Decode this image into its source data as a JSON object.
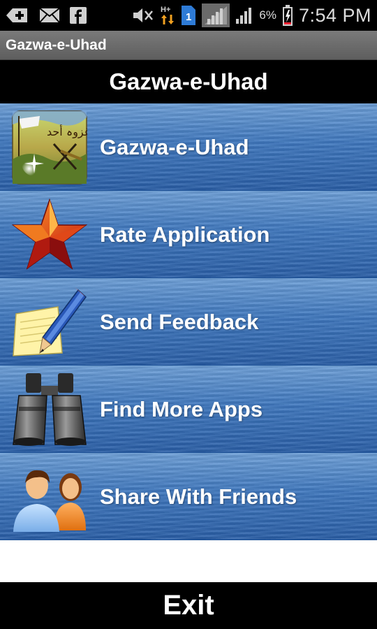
{
  "status_bar": {
    "battery_percent": "6%",
    "time": "7:54 PM",
    "sim_badge": "1",
    "network_label": "H+",
    "left_icons": [
      "add-notification-icon",
      "email-icon",
      "facebook-icon"
    ],
    "right_icons": [
      "mute-icon",
      "data-arrows-icon",
      "sim-1-icon",
      "signal-icon",
      "signal-icon",
      "battery-charging-icon"
    ]
  },
  "app_title": "Gazwa-e-Uhad",
  "header": {
    "title": "Gazwa-e-Uhad"
  },
  "menu": {
    "items": [
      {
        "label": "Gazwa-e-Uhad",
        "icon": "app-artwork-icon"
      },
      {
        "label": "Rate Application",
        "icon": "star-icon"
      },
      {
        "label": "Send Feedback",
        "icon": "pencil-note-icon"
      },
      {
        "label": "Find More Apps",
        "icon": "binoculars-icon"
      },
      {
        "label": "Share With Friends",
        "icon": "people-icon"
      }
    ]
  },
  "exit_label": "Exit",
  "colors": {
    "menu_blue": "#3f78bf",
    "header_bg": "#000000",
    "title_strip": "#6a6a6a"
  }
}
